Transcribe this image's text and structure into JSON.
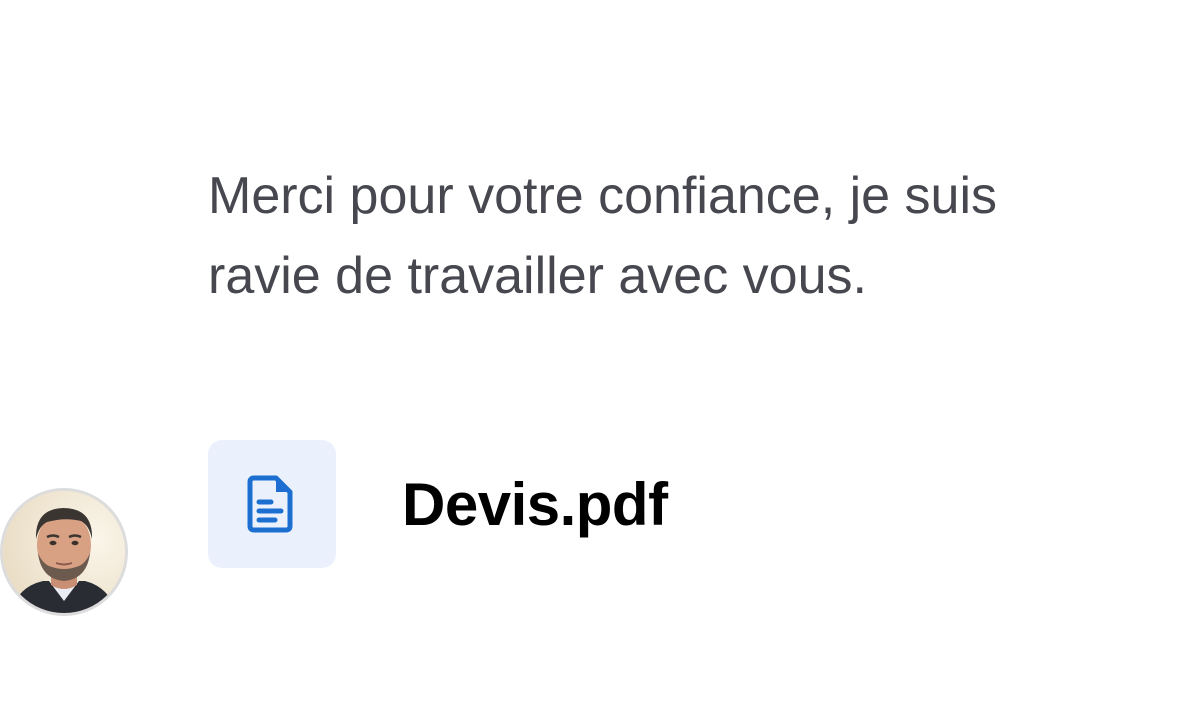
{
  "message": {
    "line1": "Merci pour votre confiance, je suis",
    "line2": "ravie de travailler avec vous."
  },
  "attachment": {
    "file_name": "Devis.pdf",
    "icon": "document-icon",
    "icon_color": "#1c6fd1",
    "tile_color": "#eaf1fc"
  },
  "sender": {
    "avatar": "avatar-photo"
  }
}
